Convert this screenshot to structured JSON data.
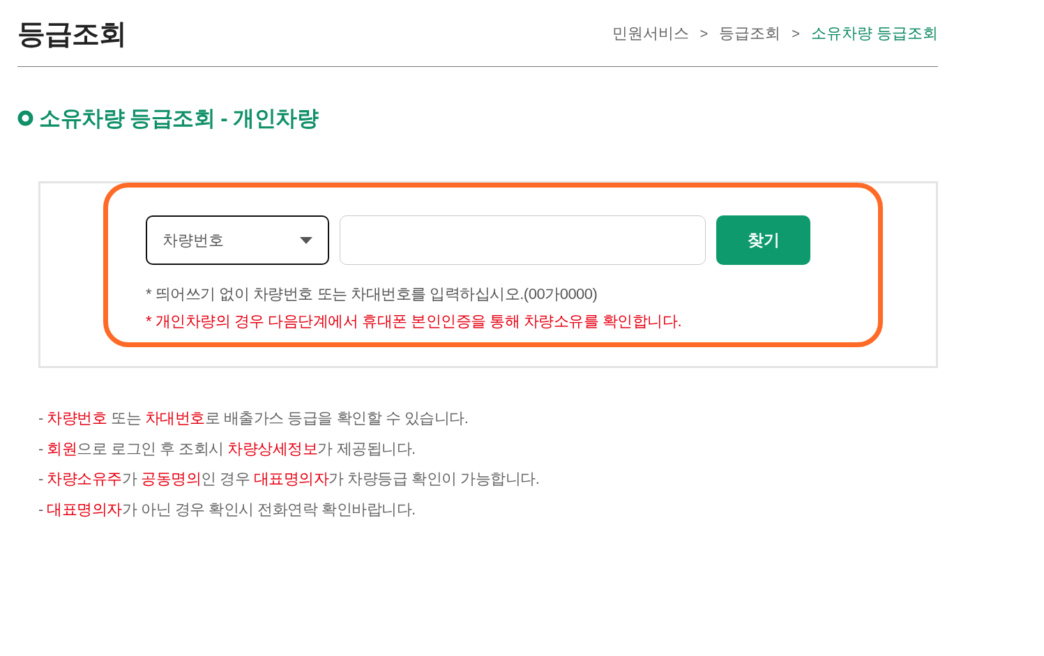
{
  "page_title": "등급조회",
  "breadcrumb": {
    "items": [
      {
        "label": "민원서비스",
        "current": false
      },
      {
        "label": "등급조회",
        "current": false
      },
      {
        "label": "소유차량 등급조회",
        "current": true
      }
    ],
    "separators": [
      ">",
      ">"
    ]
  },
  "section_title": "소유차량 등급조회 - 개인차량",
  "search_panel": {
    "highlighted": true,
    "search_type_select": {
      "value": "차량번호"
    },
    "search_button": {
      "label": "찾기"
    },
    "hints": [
      {
        "kind": "info",
        "text": "* 띄어쓰기 없이 차량번호 또는 차대번호를 입력하십시오.(00가0000)"
      },
      {
        "kind": "warning",
        "text": "* 개인차량의 경우 다음단계에서 휴대폰 본인인증을 통해 차량소유를 확인합니다."
      }
    ]
  },
  "notes": [
    {
      "segments": [
        {
          "text": "- ",
          "highlight": false
        },
        {
          "text": "차량번호",
          "highlight": true
        },
        {
          "text": " 또는 ",
          "highlight": false
        },
        {
          "text": "차대번호",
          "highlight": true
        },
        {
          "text": "로 배출가스 등급을 확인할 수 있습니다.",
          "highlight": false
        }
      ]
    },
    {
      "segments": [
        {
          "text": "- ",
          "highlight": false
        },
        {
          "text": "회원",
          "highlight": true
        },
        {
          "text": "으로 로그인 후 조회시 ",
          "highlight": false
        },
        {
          "text": "차량상세정보",
          "highlight": true
        },
        {
          "text": "가 제공됩니다.",
          "highlight": false
        }
      ]
    },
    {
      "segments": [
        {
          "text": "- ",
          "highlight": false
        },
        {
          "text": "차량소유주",
          "highlight": true
        },
        {
          "text": "가 ",
          "highlight": false
        },
        {
          "text": "공동명의",
          "highlight": true
        },
        {
          "text": "인 경우 ",
          "highlight": false
        },
        {
          "text": "대표명의자",
          "highlight": true
        },
        {
          "text": "가 차량등급 확인이 가능합니다.",
          "highlight": false
        }
      ]
    },
    {
      "segments": [
        {
          "text": "- ",
          "highlight": false
        },
        {
          "text": "대표명의자",
          "highlight": true
        },
        {
          "text": "가 아닌 경우 확인시 전화연락 확인바랍니다.",
          "highlight": false
        }
      ]
    }
  ]
}
